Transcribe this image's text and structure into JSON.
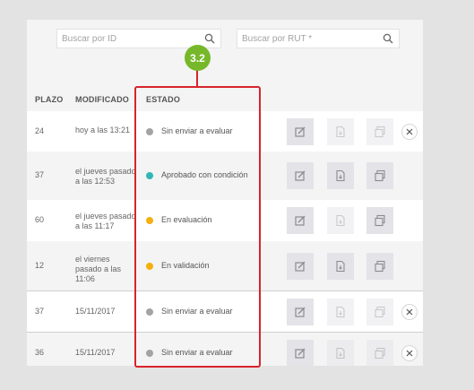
{
  "search": {
    "id_placeholder": "Buscar por ID",
    "rut_placeholder": "Buscar por RUT *"
  },
  "table": {
    "headers": {
      "plazo": "PLAZO",
      "modificado": "MODIFICADO",
      "estado": "ESTADO"
    },
    "rows": [
      {
        "plazo": "24",
        "modificado": "hoy a las 13:21",
        "estado": "Sin enviar a evaluar",
        "status_color": "#a3a3a3",
        "delete": true
      },
      {
        "plazo": "37",
        "modificado": "el jueves pasado a las 12:53",
        "estado": "Aprobado con condición",
        "status_color": "#2fb7b7",
        "delete": false
      },
      {
        "plazo": "60",
        "modificado": "el jueves pasado a las 11:17",
        "estado": "En evaluación",
        "status_color": "#f4b00f",
        "delete": false
      },
      {
        "plazo": "12",
        "modificado": "el viernes pasado a las 11:06",
        "estado": "En validación",
        "status_color": "#f4b00f",
        "delete": false
      },
      {
        "plazo": "37",
        "modificado": "15/11/2017",
        "estado": "Sin enviar a evaluar",
        "status_color": "#a3a3a3",
        "delete": true
      },
      {
        "plazo": "36",
        "modificado": "15/11/2017",
        "estado": "Sin enviar a evaluar",
        "status_color": "#a3a3a3",
        "delete": true
      }
    ]
  },
  "annotation": {
    "callout_label": "3.2",
    "highlight_color": "#d7242b",
    "callout_color": "#76b82a"
  }
}
